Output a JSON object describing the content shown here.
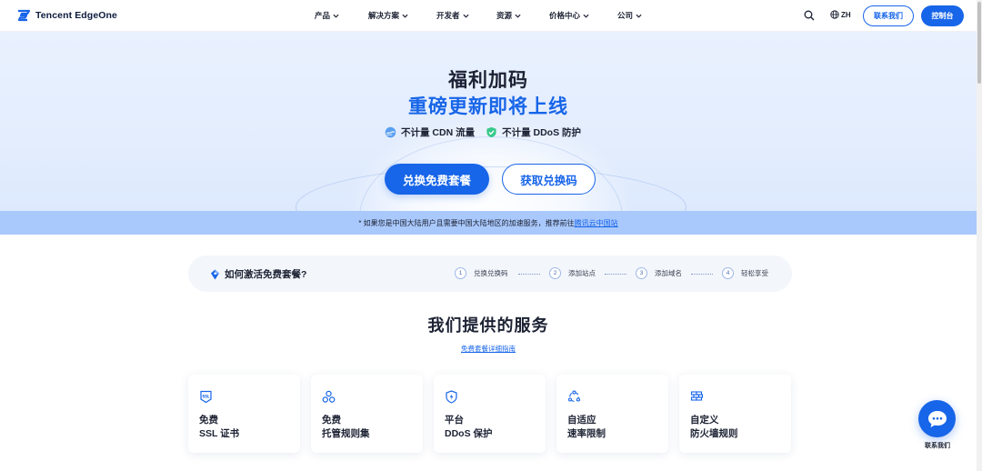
{
  "header": {
    "logo_text": "Tencent EdgeOne",
    "nav": [
      {
        "label": "产品"
      },
      {
        "label": "解决方案"
      },
      {
        "label": "开发者"
      },
      {
        "label": "资源"
      },
      {
        "label": "价格中心"
      },
      {
        "label": "公司"
      }
    ],
    "lang": "ZH",
    "contact_label": "联系我们",
    "console_label": "控制台"
  },
  "hero": {
    "title_line1": "福利加码",
    "title_line2": "重磅更新即将上线",
    "features": [
      {
        "label": "不计量 CDN 流量",
        "icon": "cloud-icon"
      },
      {
        "label": "不计量 DDoS 防护",
        "icon": "shield-check-icon"
      }
    ],
    "redeem_button": "兑换免费套餐",
    "get_code_button": "获取兑换码",
    "accent_color": "#1765e8"
  },
  "notice": {
    "text": "* 如果您是中国大陆用户且需要中国大陆地区的加速服务，推荐前往",
    "link": "腾讯云中国站"
  },
  "steps": {
    "title": "如何激活免费套餐?",
    "items": [
      {
        "num": "1",
        "label": "兑换兑换码"
      },
      {
        "num": "2",
        "label": "添加站点"
      },
      {
        "num": "3",
        "label": "添加域名"
      },
      {
        "num": "4",
        "label": "轻松享受"
      }
    ]
  },
  "services": {
    "title": "我们提供的服务",
    "guide_link": "免费套餐详细指南",
    "cards": [
      {
        "line1": "免费",
        "line2": "SSL 证书",
        "icon": "ssl-icon"
      },
      {
        "line1": "免费",
        "line2": "托管规则集",
        "icon": "rules-icon"
      },
      {
        "line1": "平台",
        "line2": "DDoS 保护",
        "icon": "shield-icon"
      },
      {
        "line1": "自适应",
        "line2": "速率限制",
        "icon": "adaptive-icon"
      },
      {
        "line1": "自定义",
        "line2": "防火墙规则",
        "icon": "firewall-icon"
      }
    ]
  },
  "float_contact": {
    "label": "联系我们"
  }
}
